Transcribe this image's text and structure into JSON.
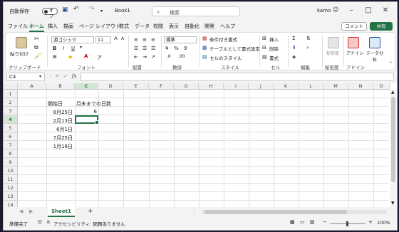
{
  "titlebar": {
    "autosave_label": "自動保存",
    "autosave_state": "オフ",
    "filename": "Book1",
    "search_placeholder": "検索",
    "user": "kamo"
  },
  "menu": {
    "tabs": [
      "ファイル",
      "ホーム",
      "挿入",
      "描画",
      "ページ レイアウト",
      "数式",
      "データ",
      "校閲",
      "表示",
      "自動化",
      "開発",
      "ヘルプ"
    ],
    "active": "ホーム",
    "comment_label": "コメント",
    "share_label": "共有"
  },
  "ribbon": {
    "paste_label": "貼り付け",
    "font_name": "游ゴシック",
    "font_size": "11",
    "number_format": "標準",
    "conditional_format": "条件付き書式",
    "format_as_table": "テーブルとして書式設定",
    "cell_styles": "セルのスタイル",
    "insert": "挿入",
    "delete": "削除",
    "format": "書式",
    "sensitivity": "秘密度",
    "addins": "アドイン",
    "data_analysis": "データ分析",
    "groups": {
      "clipboard": "クリップボード",
      "font": "フォント",
      "alignment": "配置",
      "number": "数値",
      "styles": "スタイル",
      "cells": "セル",
      "editing": "編集",
      "sensitivity": "秘密度",
      "addins": "アドイン"
    }
  },
  "formula_bar": {
    "name_box": "C4",
    "fx": "fx",
    "value": ""
  },
  "grid": {
    "columns": [
      "A",
      "B",
      "C",
      "D",
      "E",
      "F",
      "G",
      "H",
      "I",
      "J",
      "K",
      "L",
      "M",
      "N",
      "O"
    ],
    "rows": [
      "1",
      "2",
      "3",
      "4",
      "5",
      "6",
      "7",
      "8",
      "9",
      "10",
      "11",
      "12",
      "13",
      "14"
    ],
    "cells": {
      "B2": "開始日",
      "C2": "月末までの日数",
      "B3": "8月25日",
      "C3": "6",
      "B4": "2月13日",
      "B5": "6月1日",
      "B6": "7月25日",
      "B7": "1月18日"
    },
    "selected": "C4"
  },
  "sheets": {
    "tabs": [
      "Sheet1"
    ],
    "add_label": "+"
  },
  "status": {
    "ready": "準備完了",
    "accessibility": "アクセシビリティ: 問題ありません",
    "zoom": "100%"
  }
}
